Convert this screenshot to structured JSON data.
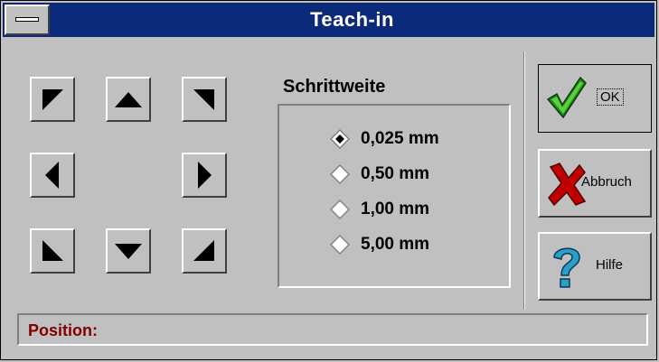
{
  "window": {
    "title": "Teach-in"
  },
  "step_group": {
    "label": "Schrittweite",
    "selected_index": 0,
    "options": [
      {
        "label": "0,025 mm",
        "selected": true
      },
      {
        "label": "0,50 mm",
        "selected": false
      },
      {
        "label": "1,00 mm",
        "selected": false
      },
      {
        "label": "5,00 mm",
        "selected": false
      }
    ]
  },
  "jog_buttons": [
    {
      "icon": "arrow-up-left-icon"
    },
    {
      "icon": "arrow-up-icon"
    },
    {
      "icon": "arrow-up-right-icon"
    },
    {
      "icon": "arrow-left-icon"
    },
    {
      "icon": "arrow-right-icon"
    },
    {
      "icon": "arrow-down-left-icon"
    },
    {
      "icon": "arrow-down-icon"
    },
    {
      "icon": "arrow-down-right-icon"
    }
  ],
  "buttons": {
    "ok": {
      "label": "OK",
      "icon": "checkmark-icon",
      "color": "#1a8a1a"
    },
    "cancel": {
      "label": "Abbruch",
      "icon": "x-mark-icon",
      "color": "#c00000"
    },
    "help": {
      "label": "Hilfe",
      "icon": "question-mark-icon",
      "color": "#2aa0c8"
    }
  },
  "status": {
    "label": "Position:"
  },
  "colors": {
    "titlebar": "#0b2a7a",
    "face": "#c0c0c0",
    "status_label": "#800000"
  }
}
